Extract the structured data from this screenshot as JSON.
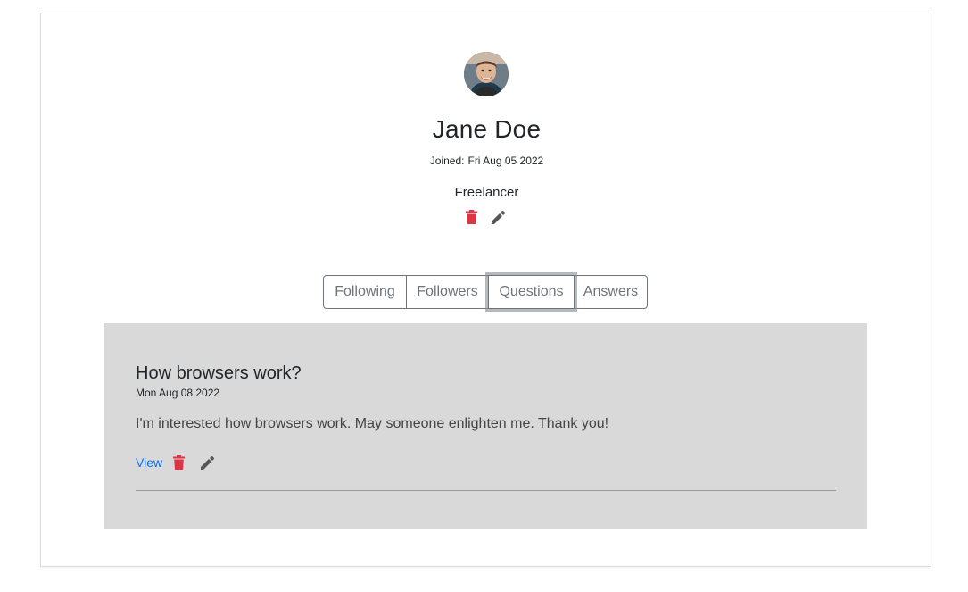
{
  "profile": {
    "name": "Jane Doe",
    "joined_label": "Joined:",
    "joined_date": "Fri Aug 05 2022",
    "occupation": "Freelancer",
    "avatar_icon": "user-photo"
  },
  "tabs": [
    {
      "label": "Following"
    },
    {
      "label": "Followers"
    },
    {
      "label": "Questions",
      "focused": true
    },
    {
      "label": "Answers"
    }
  ],
  "questions": [
    {
      "title": "How browsers work?",
      "date": "Mon Aug 08 2022",
      "body": "I'm interested how browsers work. May someone enlighten me. Thank you!",
      "view_label": "View"
    }
  ],
  "icons": {
    "delete": "trash-icon",
    "edit": "pencil-icon"
  },
  "colors": {
    "delete": "#dc3545",
    "edit": "#555555",
    "link": "#0d6efd",
    "panel": "#d9d9d9",
    "tab_border": "#6c757d"
  }
}
